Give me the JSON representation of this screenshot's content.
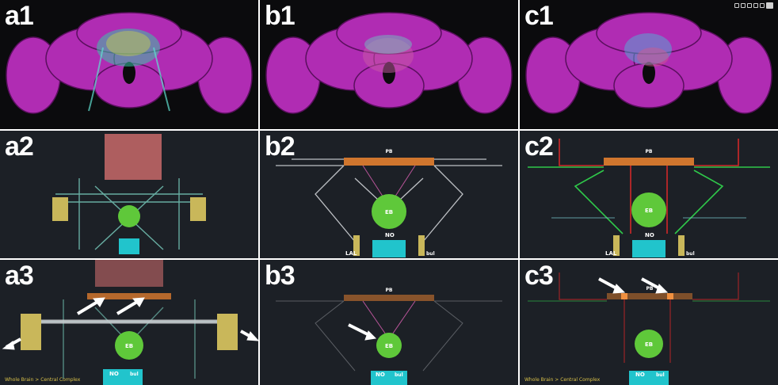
{
  "panels": {
    "a1": {
      "label": "a1"
    },
    "b1": {
      "label": "b1"
    },
    "c1": {
      "label": "c1"
    },
    "a2": {
      "label": "a2"
    },
    "b2": {
      "label": "b2",
      "pb": "PB",
      "lal": "LAL",
      "nod": "NO",
      "bul": "bul",
      "eb": "EB"
    },
    "c2": {
      "label": "c2",
      "pb": "PB",
      "lal": "LAL",
      "nod": "NO",
      "bul": "bul",
      "eb": "EB"
    },
    "a3": {
      "label": "a3",
      "breadcrumb": "Whole Brain > Central Complex",
      "nod": "NO",
      "bul": "bul",
      "eb": "EB"
    },
    "b3": {
      "label": "b3",
      "pb": "PB",
      "nod": "NO",
      "bul": "bul",
      "eb": "EB"
    },
    "c3": {
      "label": "c3",
      "breadcrumb": "Whole Brain > Central Complex",
      "pb": "PB",
      "nod": "NO",
      "bul": "bul",
      "eb": "EB"
    }
  },
  "colors": {
    "brain": "#b02cb3",
    "brain_shadow": "#5a0f5e",
    "eb_green": "#5fc83a",
    "pb_orange": "#d0762e",
    "fb_pink": "#c86a6a",
    "bulb_cyan": "#21c4cc",
    "lal_khaki": "#c9b75a",
    "red_path": "#d02828",
    "green_path": "#2fc84a",
    "gray_path": "#cfd2d6",
    "arrow": "#ffffff"
  },
  "toolbar_icons": [
    "view-icon",
    "camera-icon",
    "layers-icon",
    "settings-icon",
    "info-icon",
    "close-icon"
  ]
}
